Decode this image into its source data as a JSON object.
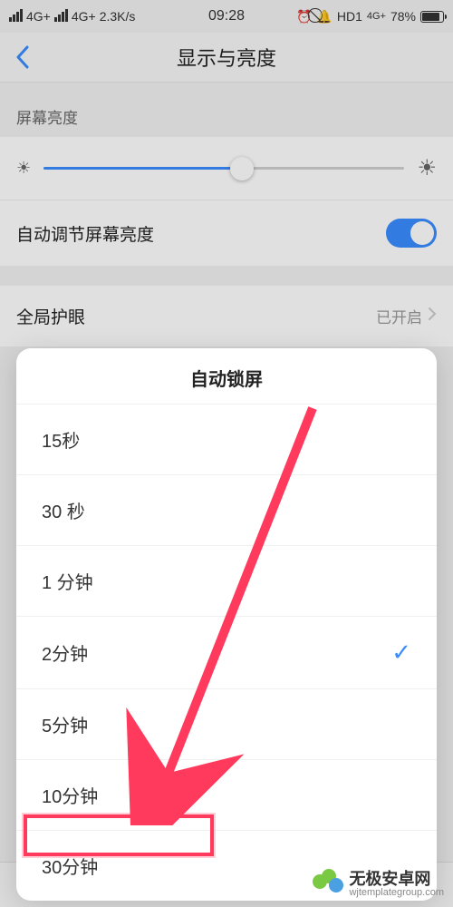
{
  "status": {
    "net1": "4G+",
    "net2": "4G+",
    "speed": "2.3K/s",
    "time": "09:28",
    "hd": "HD1",
    "net_badge": "4G+",
    "battery_pct": "78%"
  },
  "nav": {
    "title": "显示与亮度"
  },
  "brightness": {
    "label": "屏幕亮度",
    "auto_label": "自动调节屏幕亮度"
  },
  "eye": {
    "label": "全局护眼",
    "value": "已开启"
  },
  "sheet": {
    "title": "自动锁屏",
    "options": [
      {
        "label": "15秒"
      },
      {
        "label": "30 秒"
      },
      {
        "label": "1 分钟"
      },
      {
        "label": "2分钟",
        "selected": true
      },
      {
        "label": "5分钟"
      },
      {
        "label": "10分钟"
      },
      {
        "label": "30分钟"
      }
    ]
  },
  "watermark": {
    "name": "无极安卓网",
    "url": "wjtemplategroup.com"
  }
}
